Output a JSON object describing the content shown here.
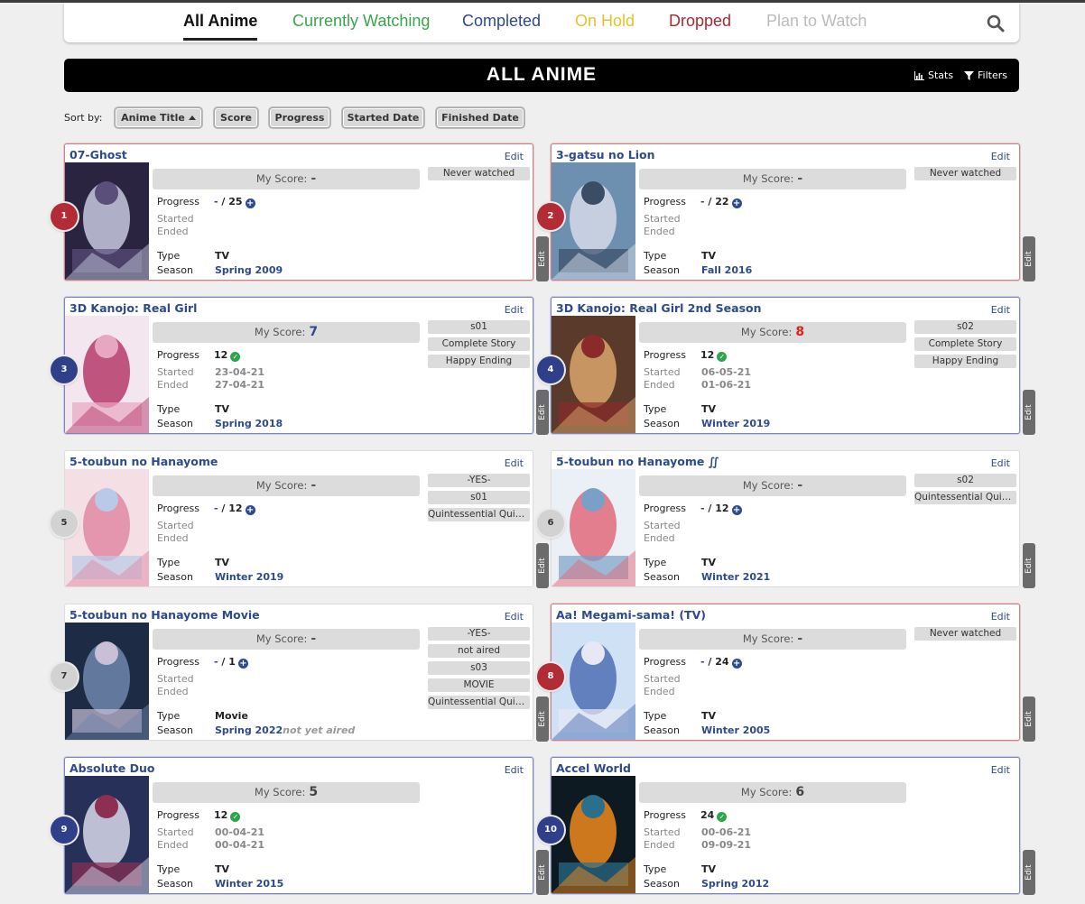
{
  "nav": {
    "tabs": [
      {
        "label": "All Anime",
        "color": "#111111"
      },
      {
        "label": "Currently Watching",
        "color": "#3aa64a"
      },
      {
        "label": "Completed",
        "color": "#2c4a8c"
      },
      {
        "label": "On Hold",
        "color": "#e3c32b"
      },
      {
        "label": "Dropped",
        "color": "#a82a34"
      },
      {
        "label": "Plan to Watch",
        "color": "#bbbbbb"
      }
    ],
    "search_icon": "search-icon"
  },
  "banner": {
    "title": "ALL ANIME",
    "stats_label": "Stats",
    "filters_label": "Filters"
  },
  "sort": {
    "label": "Sort by:",
    "buttons": [
      "Anime Title",
      "Score",
      "Progress",
      "Started Date",
      "Finished Date"
    ]
  },
  "labels": {
    "edit": "Edit",
    "my_score": "My Score:",
    "progress": "Progress",
    "started": "Started",
    "ended": "Ended",
    "type": "Type",
    "season": "Season"
  },
  "cards": [
    {
      "rank": "1",
      "title": "07-Ghost",
      "score": "-",
      "progress_current": "-",
      "progress_total": "/ 25",
      "started": "",
      "ended": "",
      "type": "TV",
      "season": "Spring 2009",
      "season_note": "",
      "tags": [
        "Never watched"
      ],
      "status": "red"
    },
    {
      "rank": "2",
      "title": "3-gatsu no Lion",
      "score": "-",
      "progress_current": "-",
      "progress_total": "/ 22",
      "started": "",
      "ended": "",
      "type": "TV",
      "season": "Fall 2016",
      "season_note": "",
      "tags": [
        "Never watched"
      ],
      "status": "red"
    },
    {
      "rank": "3",
      "title": "3D Kanojo: Real Girl",
      "score": "7",
      "progress_current": "12",
      "progress_total": "",
      "started": "23-04-21",
      "ended": "27-04-21",
      "type": "TV",
      "season": "Spring 2018",
      "season_note": "",
      "tags": [
        "s01",
        "Complete Story",
        "Happy Ending"
      ],
      "status": "blue"
    },
    {
      "rank": "4",
      "title": "3D Kanojo: Real Girl 2nd Season",
      "score": "8",
      "progress_current": "12",
      "progress_total": "",
      "started": "06-05-21",
      "ended": "01-06-21",
      "type": "TV",
      "season": "Winter 2019",
      "season_note": "",
      "tags": [
        "s02",
        "Complete Story",
        "Happy Ending"
      ],
      "status": "blue"
    },
    {
      "rank": "5",
      "title": "5-toubun no Hanayome",
      "score": "-",
      "progress_current": "-",
      "progress_total": "/ 12",
      "started": "",
      "ended": "",
      "type": "TV",
      "season": "Winter 2019",
      "season_note": "",
      "tags": [
        "-YES-",
        "s01",
        "Quintessential Quin..."
      ],
      "status": "gray"
    },
    {
      "rank": "6",
      "title": "5-toubun no Hanayome ∬",
      "score": "-",
      "progress_current": "-",
      "progress_total": "/ 12",
      "started": "",
      "ended": "",
      "type": "TV",
      "season": "Winter 2021",
      "season_note": "",
      "tags": [
        "s02",
        "Quintessential Quin..."
      ],
      "status": "gray"
    },
    {
      "rank": "7",
      "title": "5-toubun no Hanayome Movie",
      "score": "-",
      "progress_current": "-",
      "progress_total": "/ 1",
      "started": "",
      "ended": "",
      "type": "Movie",
      "season": "Spring 2022",
      "season_note": "not yet aired",
      "tags": [
        "-YES-",
        "not aired",
        "s03",
        "MOVIE",
        "Quintessential Quin..."
      ],
      "status": "gray"
    },
    {
      "rank": "8",
      "title": "Aa! Megami-sama! (TV)",
      "score": "-",
      "progress_current": "-",
      "progress_total": "/ 24",
      "started": "",
      "ended": "",
      "type": "TV",
      "season": "Winter 2005",
      "season_note": "",
      "tags": [
        "Never watched"
      ],
      "status": "red"
    },
    {
      "rank": "9",
      "title": "Absolute Duo",
      "score": "5",
      "progress_current": "12",
      "progress_total": "",
      "started": "00-04-21",
      "ended": "00-04-21",
      "type": "TV",
      "season": "Winter 2015",
      "season_note": "",
      "tags": [],
      "status": "blue"
    },
    {
      "rank": "10",
      "title": "Accel World",
      "score": "6",
      "progress_current": "24",
      "progress_total": "",
      "started": "00-06-21",
      "ended": "09-09-21",
      "type": "TV",
      "season": "Spring 2012",
      "season_note": "",
      "tags": [],
      "status": "blue"
    }
  ]
}
